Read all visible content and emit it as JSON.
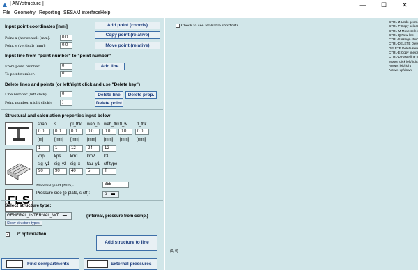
{
  "window": {
    "title": "| ANYstructure |",
    "minimize": "—",
    "maximize": "☐",
    "close": "✕"
  },
  "menu": [
    "File",
    "Geometry",
    "Reporting",
    "SESAM interface",
    "Help"
  ],
  "input_points": {
    "header": "Input point coordinates [mm]",
    "x_label": "Point x (horizontal) [mm]:",
    "x_value": "0.0",
    "y_label": "Point y (vertical)  [mm]:",
    "y_value": "0.0",
    "add_point": "Add point (coords)",
    "copy_point": "Copy point (relative)",
    "move_point": "Move point (relative)"
  },
  "input_line": {
    "header": "Input line from \"point number\" to \"point number\"",
    "from_label": "From point number:",
    "from_value": "0",
    "to_label": "To point number:",
    "to_value": "0",
    "add_line": "Add line"
  },
  "delete": {
    "header": "Delete lines and points (or left/right click and use \"Delete key\")",
    "line_label": "Line number (left click):",
    "line_value": "0",
    "point_label": "Point number (right click):",
    "point_value": ")",
    "delete_line": "Delete line",
    "delete_prop": "Delete prop.",
    "delete_point": "Delete point"
  },
  "structural": {
    "header": "Structural and calculation properties input below:",
    "row1_labels": [
      "span",
      "s",
      "pl_thk",
      "web_h",
      "web_thk",
      "fl_w",
      "fl_thk"
    ],
    "row1_values": [
      "0.0",
      "0.0",
      "0.0",
      "0.0",
      "0.0",
      "0.0",
      "0.0"
    ],
    "row1_units": [
      "[m]",
      "[mm]",
      "[mm]",
      "[mm]",
      "[mm]",
      "[mm]",
      "[mm]"
    ],
    "row2_values": [
      "1",
      "1",
      "12",
      "24",
      "12"
    ],
    "row2_labels": [
      "kpp",
      "kps",
      "km1",
      "km2",
      "k3"
    ],
    "row3_labels": [
      "sig_y1",
      "sig_y2",
      "sig_x",
      "tau_y1",
      "stf type"
    ],
    "row3_values": [
      "90",
      "90",
      "40",
      "5",
      "T"
    ],
    "fls_label": "FLS",
    "yield_label": "Material yield [MPa]:",
    "yield_value": "355",
    "pressure_label": "Pressure side (p-plate, s-stf):",
    "pressure_value": "p"
  },
  "structure_type": {
    "header": "Select structure type:",
    "selected": "GENERAL_INTERNAL_WT",
    "show_types": "Show structure types",
    "description": "(Internal, pressure from comp.)"
  },
  "z_opt": {
    "checked": "✓",
    "label": "z* optimization"
  },
  "add_structure": "Add structure to line",
  "bottom_buttons": {
    "find": "Find compartments",
    "external": "External pressures"
  },
  "canvas": {
    "check_label": "Check to see avaliable shortcuts",
    "coords": "(0, 0)"
  },
  "shortcuts": [
    "CTRL-Z Undo geometry",
    "CTRL-P Copy selected",
    "CTRL-M Move selected",
    "CTRL-Q New line",
    "CTRL-S Assign structure",
    "CTRL-DELETE Delete",
    "DELETE Delete selected",
    "CTRL-E Copy line prop",
    "CTRL-D Paste line prop",
    "Mouse click left/right",
    "Arrows left/right",
    "Arrows up/down"
  ],
  "colors": {
    "panel": "#d1e6e9",
    "button_text": "#1a3a7a",
    "button_border": "#3d6fa8"
  }
}
